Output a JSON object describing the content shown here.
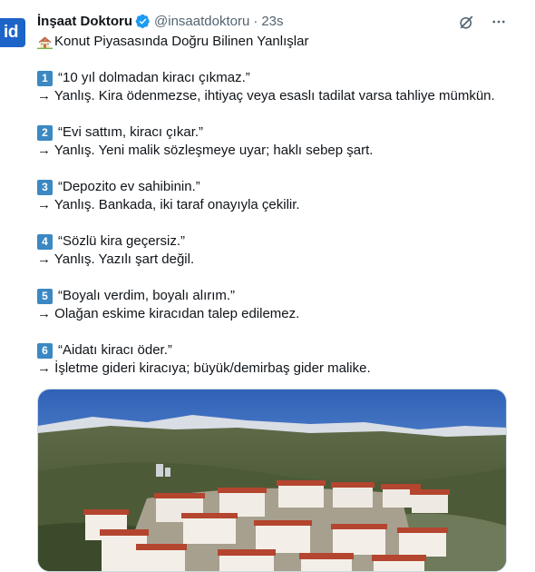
{
  "author": {
    "avatar_text": "id",
    "name": "İnşaat Doktoru",
    "handle": "@insaatdoktoru",
    "separator": "·",
    "time": "23s"
  },
  "icons": {
    "verified": "verified-badge-icon",
    "grok": "grok-icon",
    "more": "more-icon",
    "title_emoji": "house-icon"
  },
  "colors": {
    "verified": "#1d9bf0",
    "number_badge": "#3b88c3",
    "text": "#0f1419",
    "muted": "#536471"
  },
  "post": {
    "title": "Konut Piyasasında Doğru Bilinen Yanlışlar",
    "items": [
      {
        "num": "1",
        "myth": "“10 yıl dolmadan kiracı çıkmaz.”",
        "answer": "→ Yanlış. Kira ödenmezse, ihtiyaç veya esaslı tadilat varsa tahliye mümkün."
      },
      {
        "num": "2",
        "myth": "“Evi sattım, kiracı çıkar.”",
        "answer": "→ Yanlış. Yeni malik sözleşmeye uyar; haklı sebep şart."
      },
      {
        "num": "3",
        "myth": "“Depozito ev sahibinin.”",
        "answer": "→ Yanlış. Bankada, iki taraf onayıyla çekilir."
      },
      {
        "num": "4",
        "myth": "“Sözlü kira geçersiz.”",
        "answer": "→ Yanlış. Yazılı şart değil."
      },
      {
        "num": "5",
        "myth": "“Boyalı verdim, boyalı alırım.”",
        "answer": "→ Olağan eskime kiracıdan talep edilemez."
      },
      {
        "num": "6",
        "myth": "“Aidatı kiracı öder.”",
        "answer": "→ İşletme gideri kiracıya; büyük/demirbaş gider malike."
      }
    ]
  }
}
